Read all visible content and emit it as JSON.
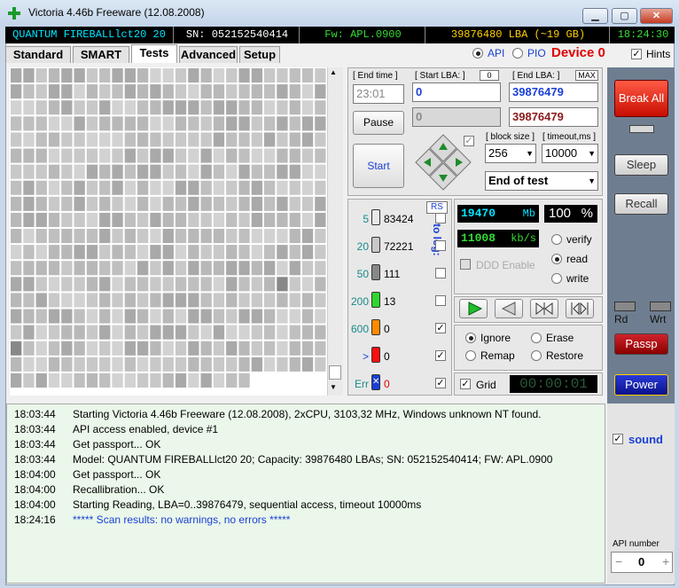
{
  "window": {
    "title": "Victoria 4.46b Freeware (12.08.2008)"
  },
  "infobar": {
    "model": "QUANTUM FIREBALLlct20 20",
    "serial": "SN: 052152540414",
    "firmware": "Fw: APL.0900",
    "lba": "39876480 LBA (~19 GB)",
    "clock": "18:24:30"
  },
  "tabs": [
    "Standard",
    "SMART",
    "Tests",
    "Advanced",
    "Setup"
  ],
  "interface": {
    "api": "API",
    "pio": "PIO",
    "device": "Device 0",
    "hints": "Hints"
  },
  "range": {
    "end_time_label": "[ End time ]",
    "end_time": "23:01",
    "start_lba_label": "[ Start LBA: ]",
    "start_lba_zero": "0",
    "start_lba": "0",
    "end_lba_label": "[ End LBA: ]",
    "max": "MAX",
    "end_lba": "39876479",
    "current_lba": "0",
    "end_lba2": "39876479"
  },
  "buttons": {
    "pause": "Pause",
    "start": "Start",
    "break_all": "Break All",
    "sleep": "Sleep",
    "recall": "Recall",
    "passp": "Passp",
    "power": "Power"
  },
  "block": {
    "block_size_label": "[ block size ]",
    "block_size": "256",
    "timeout_label": "[ timeout,ms ]",
    "timeout": "10000",
    "end_action": "End of test"
  },
  "stats": {
    "rs": "RS",
    "to_log": "to log:",
    "rows": [
      {
        "ms": "5",
        "count": "83424"
      },
      {
        "ms": "20",
        "count": "72221"
      },
      {
        "ms": "50",
        "count": "111"
      },
      {
        "ms": "200",
        "count": "13"
      },
      {
        "ms": "600",
        "count": "0"
      },
      {
        "ms": ">",
        "count": "0"
      },
      {
        "ms": "Err",
        "count": "0"
      }
    ]
  },
  "progress": {
    "mb": "19470",
    "mb_unit": "Mb",
    "percent": "100",
    "percent_unit": "%",
    "speed": "11008",
    "speed_unit": "kb/s",
    "ddd": "DDD Enable",
    "verify": "verify",
    "read": "read",
    "write": "write"
  },
  "modes": {
    "ignore": "Ignore",
    "erase": "Erase",
    "remap": "Remap",
    "restore": "Restore",
    "grid": "Grid",
    "timer": "00:00:01"
  },
  "right": {
    "rd": "Rd",
    "wrt": "Wrt",
    "sound": "sound",
    "api_number_label": "API number",
    "api_number": "0",
    "minus": "−",
    "plus": "+"
  },
  "log": [
    {
      "time": "18:03:44",
      "msg": "Starting Victoria 4.46b Freeware (12.08.2008), 2xCPU, 3103,32 MHz, Windows unknown NT found."
    },
    {
      "time": "18:03:44",
      "msg": "API access enabled, device #1"
    },
    {
      "time": "18:03:44",
      "msg": "Get passport... OK"
    },
    {
      "time": "18:03:44",
      "msg": "Model: QUANTUM FIREBALLlct20 20; Capacity: 39876480 LBAs; SN: 052152540414; FW: APL.0900"
    },
    {
      "time": "18:04:00",
      "msg": "Get passport... OK"
    },
    {
      "time": "18:04:00",
      "msg": "Recallibration... OK"
    },
    {
      "time": "18:04:00",
      "msg": "Starting Reading, LBA=0..39876479, sequential access, timeout 10000ms"
    },
    {
      "time": "18:24:16",
      "msg": "***** Scan results: no warnings, no errors *****"
    }
  ],
  "colors": {
    "mb": "#00e5ff",
    "speed": "#33dd33",
    "device": "#e00000",
    "log_result": "#1a3fd6"
  }
}
